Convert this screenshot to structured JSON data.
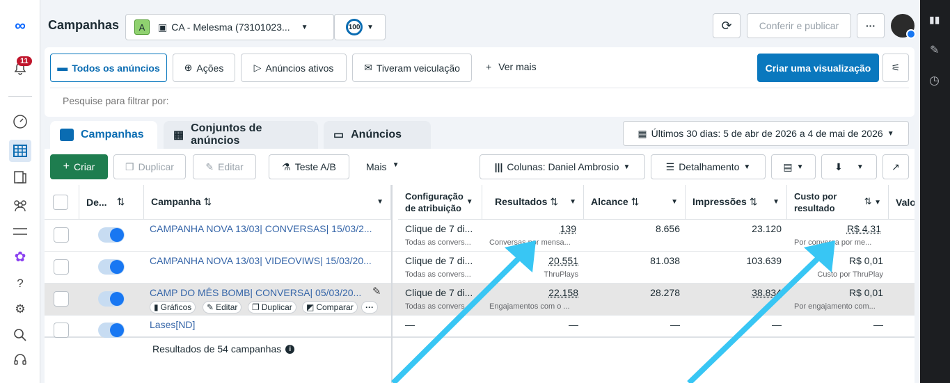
{
  "nav": {
    "notification_count": "11"
  },
  "header": {
    "title": "Campanhas",
    "account_badge": "A",
    "account_name": "CA - Melesma (73101023...",
    "score": "100",
    "review_publish": "Conferir e publicar",
    "more": "···"
  },
  "filters": {
    "all_ads": "Todos os anúncios",
    "actions": "Ações",
    "active_ads": "Anúncios ativos",
    "delivered": "Tiveram veiculação",
    "see_more": "Ver mais",
    "create_view": "Criar uma visualização"
  },
  "search": {
    "placeholder": "Pesquise para filtrar por:"
  },
  "tabs": [
    {
      "label": "Campanhas"
    },
    {
      "label": "Conjuntos de anúncios"
    },
    {
      "label": "Anúncios"
    }
  ],
  "date_range": "Últimos 30 dias: 5 de abr de 2026 a 4 de mai de 2026",
  "toolbar": {
    "create": "Criar",
    "duplicate": "Duplicar",
    "edit": "Editar",
    "ab_test": "Teste A/B",
    "more": "Mais",
    "columns": "Colunas: Daniel Ambrosio",
    "breakdown": "Detalhamento"
  },
  "columns": {
    "delivery": "De...",
    "campaign": "Campanha",
    "attribution_1": "Configuração",
    "attribution_2": "de atribuição",
    "results": "Resultados",
    "reach": "Alcance",
    "impressions": "Impressões",
    "cost_1": "Custo por",
    "cost_2": "resultado",
    "value": "Valo"
  },
  "rows": [
    {
      "name": "CAMPANHA NOVA 13/03| CONVERSAS| 15/03/2...",
      "attribution": "Clique de 7 di...",
      "attribution_sub": "Todas as convers...",
      "results": "139",
      "results_sub": "Conversas por mensa...",
      "reach": "8.656",
      "impressions": "23.120",
      "cost": "R$ 4,31",
      "cost_sub": "Por conversa por me..."
    },
    {
      "name": "CAMPANHA NOVA 13/03| VIDEOVIWS| 15/03/20...",
      "attribution": "Clique de 7 di...",
      "attribution_sub": "Todas as convers...",
      "results": "20.551",
      "results_sub": "ThruPlays",
      "reach": "81.038",
      "impressions": "103.639",
      "cost": "R$ 0,01",
      "cost_sub": "Custo por ThruPlay"
    },
    {
      "name": "CAMP DO MÊS BOMB| CONVERSA| 05/03/20...",
      "attribution": "Clique de 7 di...",
      "attribution_sub": "Todas as convers...",
      "results": "22.158",
      "results_sub": "Engajamentos com o ...",
      "reach": "28.278",
      "impressions": "38.834",
      "cost": "R$ 0,01",
      "cost_sub": "Por engajamento com..."
    },
    {
      "name": "Lases[ND]",
      "attribution": "—",
      "results": "—",
      "reach": "—",
      "impressions": "—",
      "cost": "—"
    }
  ],
  "row_actions": {
    "charts": "Gráficos",
    "edit": "Editar",
    "duplicate": "Duplicar",
    "compare": "Comparar"
  },
  "footer": {
    "summary": "Resultados de 54 campanhas"
  },
  "colors": {
    "accent": "#0a78be",
    "link": "#3565a8",
    "create": "#1e7d4f",
    "annotation_arrow": "#38c6f4"
  }
}
